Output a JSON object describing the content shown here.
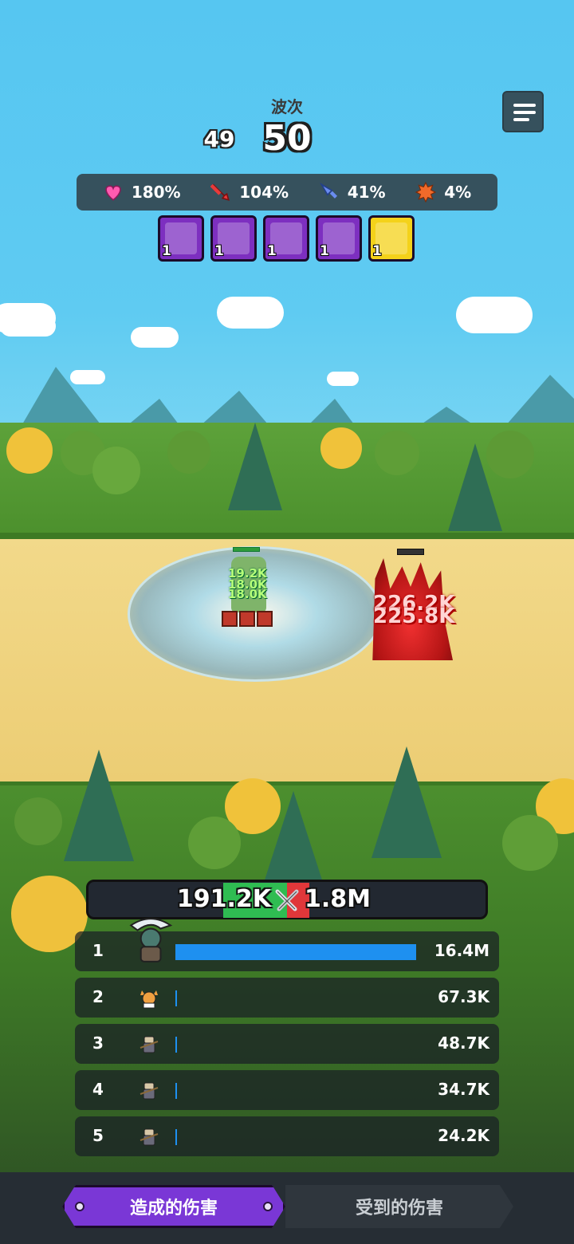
{
  "wave": {
    "label": "波次",
    "previous": "49",
    "current": "50"
  },
  "stats": [
    {
      "icon": "heart-icon",
      "value": "180%",
      "color": "#ff5bb0"
    },
    {
      "icon": "sword-icon",
      "value": "104%",
      "color": "#e83a3a"
    },
    {
      "icon": "dagger-icon",
      "value": "41%",
      "color": "#6a8cf0"
    },
    {
      "icon": "crit-gear-icon",
      "value": "4%",
      "color": "#f06a2a"
    }
  ],
  "skills": [
    {
      "icon": "army-skill-icon",
      "level": "1"
    },
    {
      "icon": "swarm-skill-icon",
      "level": "1"
    },
    {
      "icon": "boulder-skill-icon",
      "level": "1"
    },
    {
      "icon": "vortex-skill-icon",
      "level": "1"
    },
    {
      "icon": "sun-skill-icon",
      "level": "1"
    }
  ],
  "battle": {
    "hero_damage_texts": [
      "19.2K",
      "18.0K",
      "18.0K"
    ],
    "enemy_damage_texts": [
      "226.2K",
      "225.8K"
    ]
  },
  "versus": {
    "dealt": "191.2K",
    "taken": "1.8M"
  },
  "damage_rows": [
    {
      "rank": "1",
      "value": "16.4M",
      "fill": 1.0,
      "avatar": "scythe-hero-avatar"
    },
    {
      "rank": "2",
      "value": "67.3K",
      "fill": 0.004,
      "avatar": "fox-hero-avatar"
    },
    {
      "rank": "3",
      "value": "48.7K",
      "fill": 0.003,
      "avatar": "soldier-avatar"
    },
    {
      "rank": "4",
      "value": "34.7K",
      "fill": 0.002,
      "avatar": "soldier-avatar"
    },
    {
      "rank": "5",
      "value": "24.2K",
      "fill": 0.0015,
      "avatar": "soldier-avatar"
    }
  ],
  "tabs": {
    "dealt_label": "造成的伤害",
    "taken_label": "受到的伤害",
    "active": "dealt"
  }
}
